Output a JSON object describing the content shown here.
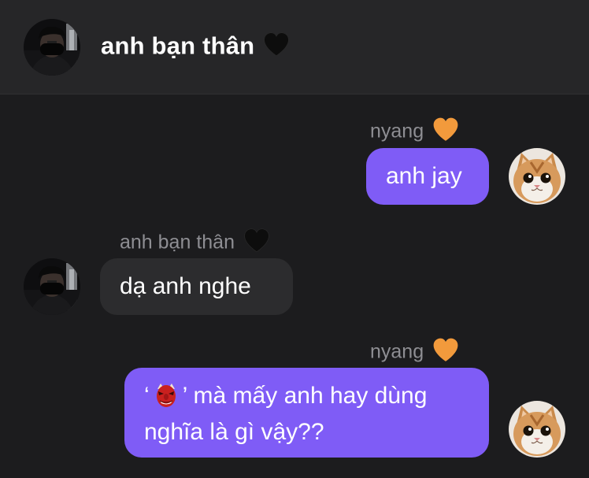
{
  "header": {
    "title": "anh bạn thân",
    "title_emoji": "black-heart",
    "avatar": "friend-avatar"
  },
  "messages": [
    {
      "direction": "outgoing",
      "sender": "nyang",
      "sender_emoji": "orange-heart",
      "text": "anh jay",
      "avatar": "cat-avatar"
    },
    {
      "direction": "incoming",
      "sender": "anh bạn thân",
      "sender_emoji": "black-heart",
      "text": "dạ anh nghe",
      "avatar": "friend-avatar"
    },
    {
      "direction": "outgoing",
      "sender": "nyang",
      "sender_emoji": "orange-heart",
      "text_open_quote": "‘",
      "text_emoji": "goblin-mask",
      "text_line1_rest": "’ mà mấy anh hay dùng",
      "text_line2": "nghĩa là gì vậy??",
      "avatar": "cat-avatar"
    }
  ],
  "colors": {
    "background": "#1c1c1e",
    "header_background": "#262628",
    "outgoing_bubble": "#7f5cf6",
    "incoming_bubble": "#2c2c2e",
    "sender_name": "#8e8e93",
    "orange_heart": "#f29a3c",
    "black_heart": "#0d0d0d"
  }
}
